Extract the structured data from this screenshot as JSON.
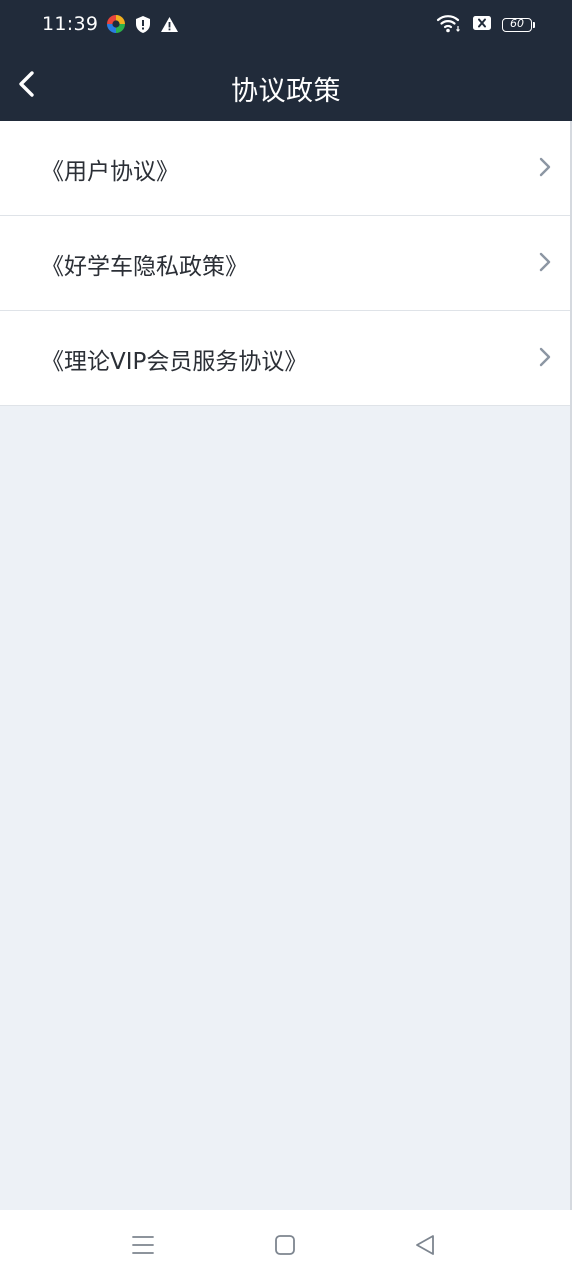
{
  "status_bar": {
    "time": "11:39",
    "battery_level": "60",
    "icons": [
      "pinwheel-app-icon",
      "shield-alert-icon",
      "warning-icon",
      "wifi-icon",
      "sim-blocked-icon",
      "battery-icon"
    ]
  },
  "nav": {
    "title": "协议政策",
    "back_icon": "chevron-left-icon"
  },
  "agreements": [
    {
      "label": "《用户协议》"
    },
    {
      "label": "《好学车隐私政策》"
    },
    {
      "label": "《理论VIP会员服务协议》"
    }
  ],
  "system_nav": {
    "buttons": [
      "menu-icon",
      "home-square-icon",
      "back-triangle-icon"
    ]
  },
  "colors": {
    "header_bg": "#212b3a",
    "page_bg": "#edf1f6",
    "item_bg": "#ffffff",
    "text": "#2b2f36",
    "chevron": "#8c96a3"
  }
}
